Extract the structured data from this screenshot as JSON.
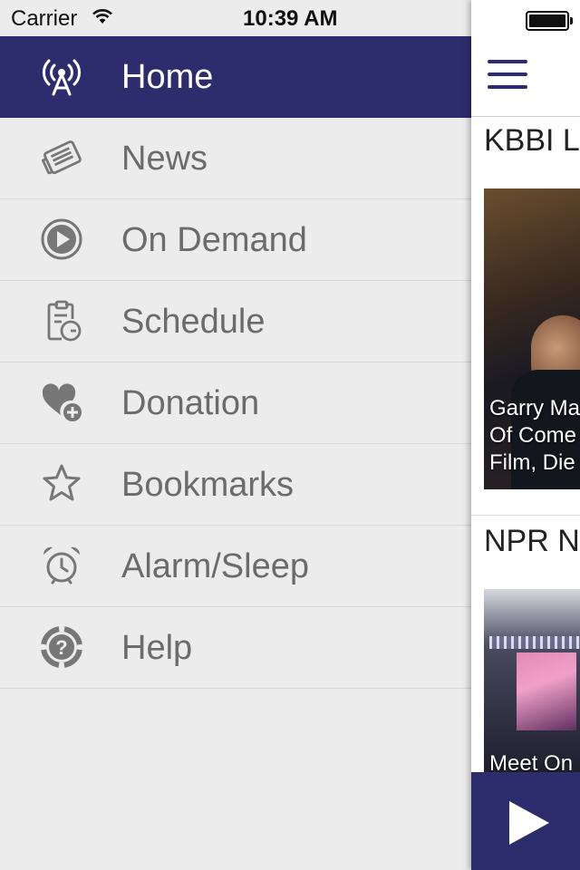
{
  "status_bar": {
    "carrier": "Carrier",
    "time": "10:39 AM"
  },
  "menu": {
    "items": [
      {
        "label": "Home",
        "icon": "radio-tower-icon",
        "active": true
      },
      {
        "label": "News",
        "icon": "newspaper-icon",
        "active": false
      },
      {
        "label": "On Demand",
        "icon": "play-circle-icon",
        "active": false
      },
      {
        "label": "Schedule",
        "icon": "clipboard-clock-icon",
        "active": false
      },
      {
        "label": "Donation",
        "icon": "heart-plus-icon",
        "active": false
      },
      {
        "label": "Bookmarks",
        "icon": "star-icon",
        "active": false
      },
      {
        "label": "Alarm/Sleep",
        "icon": "alarm-clock-icon",
        "active": false
      },
      {
        "label": "Help",
        "icon": "help-buoy-icon",
        "active": false
      }
    ]
  },
  "content": {
    "sections": [
      {
        "title": "KBBI L",
        "caption_lines": [
          "Garry Ma",
          "Of Come",
          "Film, Die"
        ]
      },
      {
        "title": "NPR N",
        "caption_lines": [
          "Meet On"
        ]
      }
    ]
  },
  "colors": {
    "accent": "#2d2d6e",
    "menu_bg": "#ececec",
    "menu_text": "#6b6b6b",
    "icon": "#777777"
  }
}
